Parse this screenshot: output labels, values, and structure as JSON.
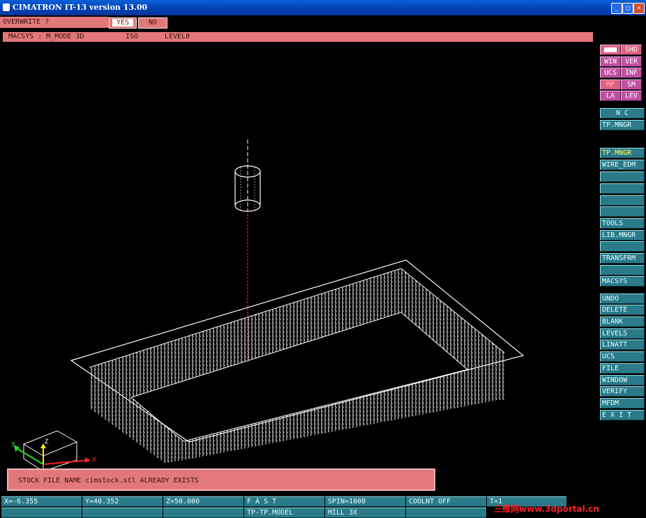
{
  "window": {
    "title": "CIMATRON IT-13 version 13.00",
    "min": "_",
    "max": "□",
    "close": "×"
  },
  "prompt": {
    "label": "OVERWRITE ?",
    "yes": "YES",
    "no": "NO"
  },
  "viewbar": {
    "macsys": "MACSYS : M_MODE 3D",
    "view": "ISO",
    "level": "LEVEL0"
  },
  "toggles": [
    [
      "",
      "SHD"
    ],
    [
      "WIN",
      "VER"
    ],
    [
      "UCS",
      "INF"
    ],
    [
      "MP",
      "SM"
    ],
    [
      "LA",
      "LEV"
    ]
  ],
  "menu_top": [
    "N C",
    "TP.MNGR"
  ],
  "menu_mid": [
    "TP.MNGR",
    "WIRE_EDM",
    "",
    "",
    "",
    "",
    "TOOLS",
    "LIB.MNGR",
    "",
    "TRANSFRM",
    "",
    "MACSYS"
  ],
  "menu_bottom": [
    "UNDO",
    "DELETE",
    "BLANK",
    "LEVELS",
    "LINATT",
    "UCS",
    "FILE",
    "WINDOW",
    "VERIFY",
    "MFDM",
    "E X I T"
  ],
  "message": "STOCK  FILE NAME cimstock.stl ALREADY EXISTS",
  "status_row1": [
    "X=-6.355",
    "Y=40.352",
    "Z=50.000",
    "F A S T",
    "SPIN=1000",
    "COOLNT OFF",
    "T=1"
  ],
  "status_row2": [
    "TP-TP.MODEL",
    "MILL 3X"
  ],
  "axis": {
    "x": "X",
    "y": "Y",
    "z": "Z"
  },
  "watermark": "三维网www.3dportal.cn",
  "colors": {
    "accent_pink": "#e2787a",
    "menu_teal": "#2a7a8a",
    "title_blue": "#0040b0",
    "toolpath_red": "#ff2020"
  }
}
